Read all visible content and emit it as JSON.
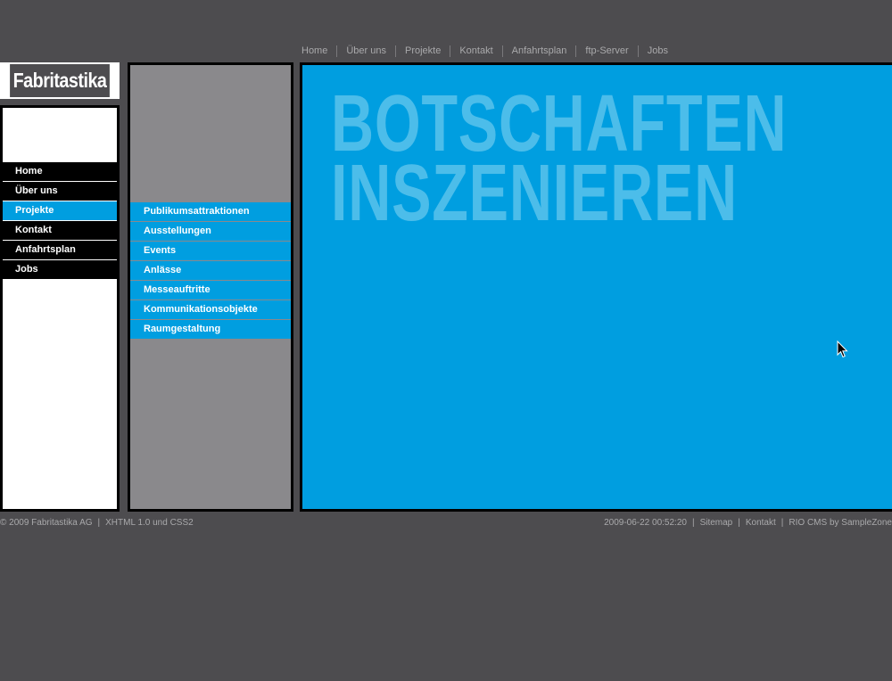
{
  "top_nav": [
    "Home",
    "Über uns",
    "Projekte",
    "Kontakt",
    "Anfahrtsplan",
    "ftp-Server",
    "Jobs"
  ],
  "logo": "Fabritastika",
  "left_nav": {
    "items": [
      "Home",
      "Über uns",
      "Projekte",
      "Kontakt",
      "Anfahrtsplan",
      "Jobs"
    ],
    "active": "Projekte"
  },
  "sub_nav": [
    "Publikumsattraktionen",
    "Ausstellungen",
    "Events",
    "Anlässe",
    "Messeauftritte",
    "Kommunikationsobjekte",
    "Raumgestaltung"
  ],
  "hero": {
    "line1": "BOTSCHAFTEN",
    "line2": "INSZENIEREN"
  },
  "footer": {
    "copyright": "© 2009 Fabritastika AG",
    "tech": "XHTML 1.0 und CSS2",
    "timestamp": "2009-06-22 00:52:20",
    "sitemap": "Sitemap",
    "kontakt": "Kontakt",
    "cms": "RIO CMS by SampleZone"
  },
  "colors": {
    "background": "#4d4c4f",
    "accent": "#009ee0",
    "hero_text": "#4cbdea",
    "panel_gray": "#8a898c"
  },
  "icons": {
    "cursor": "arrow-cursor-icon"
  }
}
